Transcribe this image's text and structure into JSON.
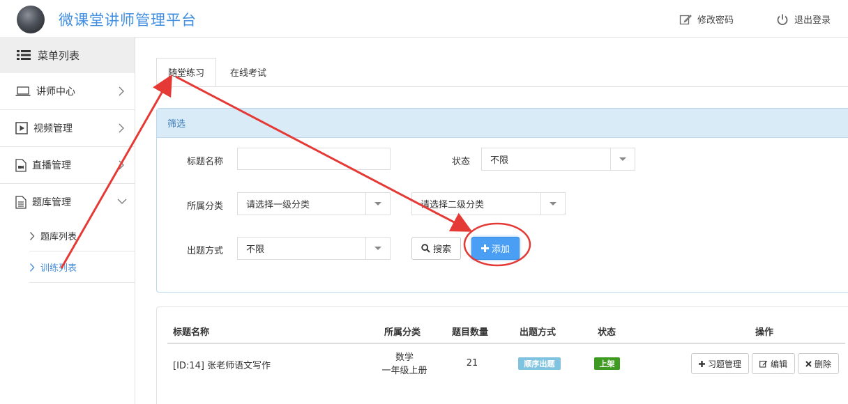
{
  "header": {
    "title": "微课堂讲师管理平台",
    "change_password": "修改密码",
    "logout": "退出登录"
  },
  "sidebar": {
    "menu_title": "菜单列表",
    "items": [
      {
        "label": "讲师中心",
        "icon": "laptop-icon"
      },
      {
        "label": "视频管理",
        "icon": "play-icon"
      },
      {
        "label": "直播管理",
        "icon": "camera-file-icon"
      },
      {
        "label": "题库管理",
        "icon": "document-icon"
      }
    ],
    "sub_items": [
      {
        "label": "题库列表"
      },
      {
        "label": "训练列表"
      }
    ]
  },
  "tabs": [
    {
      "label": "随堂练习",
      "active": true
    },
    {
      "label": "在线考试",
      "active": false
    }
  ],
  "filter": {
    "heading": "筛选",
    "title_label": "标题名称",
    "title_value": "",
    "status_label": "状态",
    "status_value": "不限",
    "category_label": "所属分类",
    "category1_value": "请选择一级分类",
    "category2_value": "请选择二级分类",
    "method_label": "出题方式",
    "method_value": "不限",
    "search_btn": "搜索",
    "add_btn": "添加"
  },
  "table": {
    "columns": [
      "标题名称",
      "所属分类",
      "题目数量",
      "出题方式",
      "状态",
      "操作"
    ],
    "rows": [
      {
        "title": "[ID:14] 张老师语文写作",
        "category_line1": "数学",
        "category_line2": "一年级上册",
        "count": "21",
        "method": "顺序出题",
        "status": "上架",
        "actions": [
          "习题管理",
          "编辑",
          "删除"
        ]
      }
    ]
  },
  "colors": {
    "brand": "#3f8ee0",
    "add_button": "#4a9ff5",
    "method_badge": "#7fc3e0",
    "status_badge": "#3f9a22",
    "annotation": "#e53935"
  }
}
